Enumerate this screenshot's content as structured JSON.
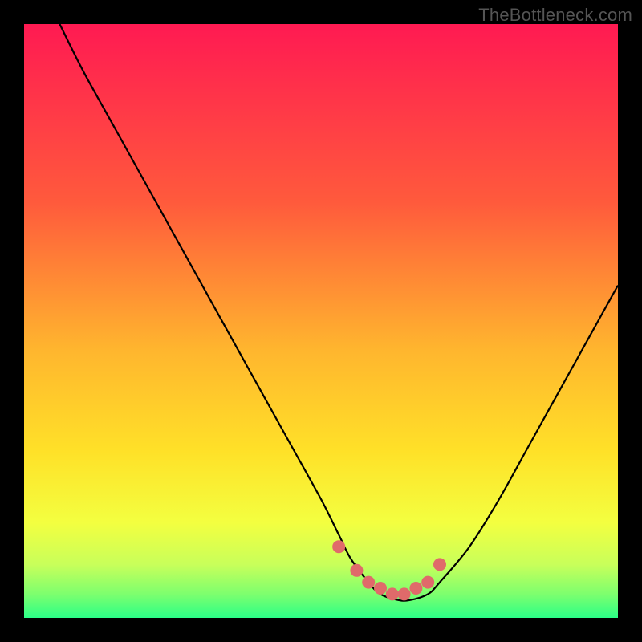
{
  "watermark": "TheBottleneck.com",
  "chart_data": {
    "type": "line",
    "title": "",
    "xlabel": "",
    "ylabel": "",
    "xlim": [
      0,
      100
    ],
    "ylim": [
      0,
      100
    ],
    "grid": false,
    "series": [
      {
        "name": "curve",
        "x": [
          6,
          10,
          15,
          20,
          25,
          30,
          35,
          40,
          45,
          50,
          53,
          55,
          58,
          60,
          63,
          65,
          68,
          70,
          75,
          80,
          85,
          90,
          95,
          100
        ],
        "y": [
          100,
          92,
          83,
          74,
          65,
          56,
          47,
          38,
          29,
          20,
          14,
          10,
          6,
          4,
          3,
          3,
          4,
          6,
          12,
          20,
          29,
          38,
          47,
          56
        ]
      }
    ],
    "highlights": {
      "name": "dots",
      "x": [
        53,
        56,
        58,
        60,
        62,
        64,
        66,
        68,
        70
      ],
      "y": [
        12,
        8,
        6,
        5,
        4,
        4,
        5,
        6,
        9
      ]
    },
    "background_gradient": {
      "stops": [
        {
          "offset": 0.0,
          "color": "#ff1a52"
        },
        {
          "offset": 0.3,
          "color": "#ff5a3c"
        },
        {
          "offset": 0.55,
          "color": "#ffb62e"
        },
        {
          "offset": 0.72,
          "color": "#ffe128"
        },
        {
          "offset": 0.84,
          "color": "#f3ff40"
        },
        {
          "offset": 0.91,
          "color": "#c8ff5a"
        },
        {
          "offset": 0.96,
          "color": "#7dff6e"
        },
        {
          "offset": 1.0,
          "color": "#2bff87"
        }
      ]
    }
  }
}
